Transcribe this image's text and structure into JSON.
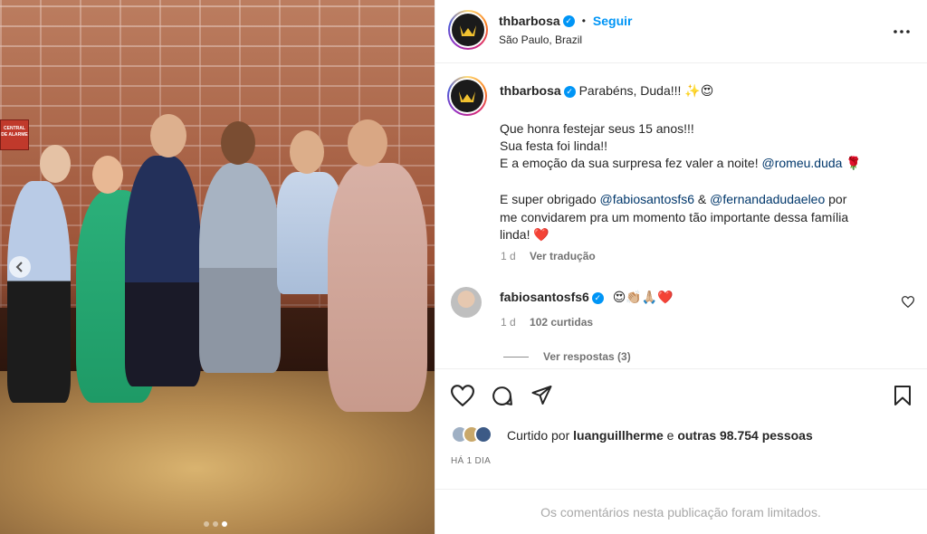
{
  "header": {
    "username": "thbarbosa",
    "follow_label": "Seguir",
    "separator": "•",
    "location": "São Paulo, Brazil",
    "more_label": "•••"
  },
  "photo": {
    "alarm_text": "CENTRAL DE ALARME",
    "carousel_total": 3,
    "carousel_active": 3
  },
  "caption": {
    "username": "thbarbosa",
    "first_line": "Parabéns, Duda!!! ✨😍",
    "line1": "Que honra festejar seus 15 anos!!!",
    "line2": "Sua festa foi linda!!",
    "line3_pre": "E a emoção da sua surpresa fez valer a noite! ",
    "line3_mention": "@romeu.duda",
    "line3_post": " 🌹",
    "line4_pre": "E super obrigado ",
    "line4_mention1": "@fabiosantosfs6",
    "line4_mid": " & ",
    "line4_mention2": "@fernandadudaeleo",
    "line4_post": " por",
    "line5": "me convidarem pra um momento tão importante dessa família",
    "line6": "linda! ❤️",
    "time": "1 d",
    "translate_label": "Ver tradução"
  },
  "comment": {
    "username": "fabiosantosfs6",
    "text": "😍👏🏼🙏🏼❤️",
    "time": "1 d",
    "likes": "102 curtidas",
    "replies_label": "Ver respostas (3)"
  },
  "likes": {
    "prefix": "Curtido por ",
    "user": "luanguillherme",
    "mid": " e ",
    "others": "outras 98.754 pessoas"
  },
  "timestamp": "HÁ 1 DIA",
  "footer_text": "Os comentários nesta publicação foram limitados.",
  "colors": {
    "accent": "#0095f6",
    "mention": "#00376b",
    "heart": "#ed4956"
  }
}
